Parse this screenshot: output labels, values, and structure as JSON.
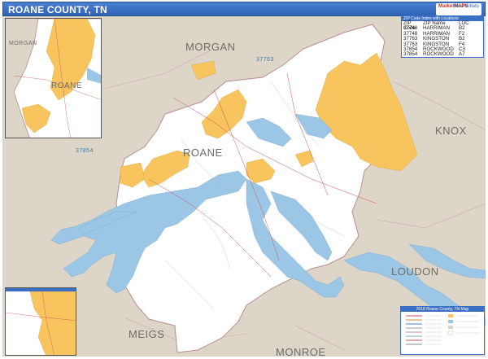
{
  "title": "ROANE COUNTY, TN",
  "logo": {
    "top": "MarketMAPS",
    "side": "Rand McNally"
  },
  "counties": [
    {
      "name": "MORGAN"
    },
    {
      "name": "ROANE"
    },
    {
      "name": "KNOX"
    },
    {
      "name": "MEIGS"
    },
    {
      "name": "MONROE"
    },
    {
      "name": "LOUDON"
    }
  ],
  "inset_labels": {
    "top_left_county_1": "MORGAN",
    "top_left_county_2": "ROANE"
  },
  "zip_labels": [
    "37763",
    "37854"
  ],
  "zip_table": {
    "header": "ZIP Code Index with Locations",
    "columns": [
      "ZIP Code",
      "ZIP Name",
      "LOC"
    ],
    "rows": [
      [
        "37748",
        "HARRIMAN",
        "B2"
      ],
      [
        "37748",
        "HARRIMAN",
        "F2"
      ],
      [
        "37763",
        "KINGSTON",
        "B2"
      ],
      [
        "37763",
        "KINGSTON",
        "F4"
      ],
      [
        "37854",
        "ROCKWOOD",
        "C3"
      ],
      [
        "37854",
        "ROCKWOOD",
        "A7"
      ]
    ]
  },
  "legend": {
    "title": "2018 Roane County, TN Map"
  },
  "colors": {
    "water": "#9cc6e6",
    "urban": "#f7c45e",
    "land": "#ffffff",
    "outside": "#ddd6c8",
    "title_bar": "#2f63b6"
  }
}
